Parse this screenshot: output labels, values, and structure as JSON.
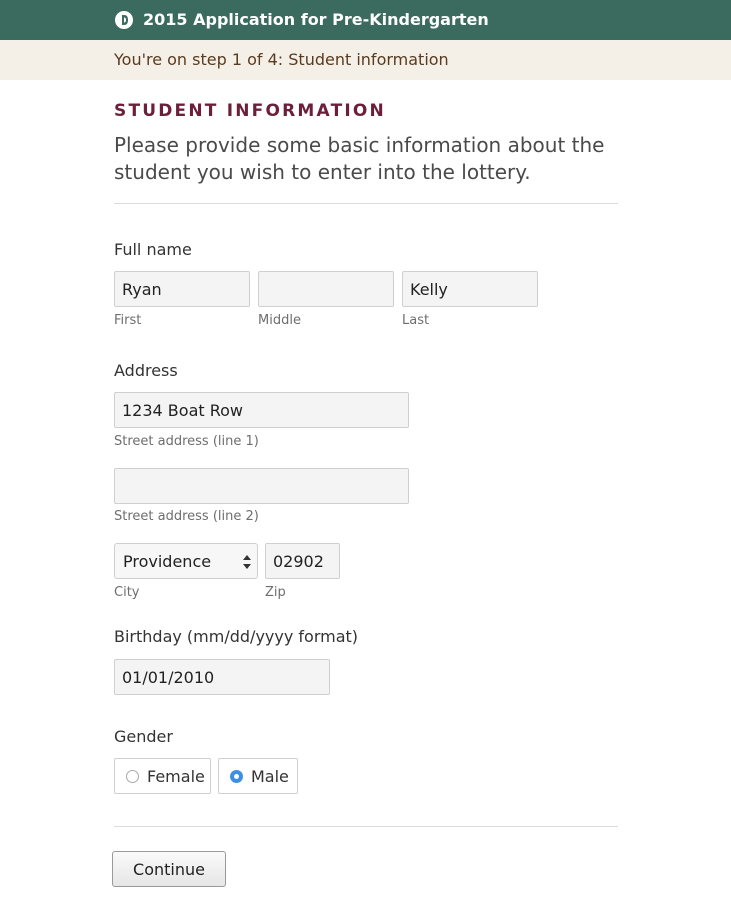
{
  "header": {
    "title": "2015 Application for Pre-Kindergarten",
    "logo_icon": "logo-icon"
  },
  "step": {
    "text": "You're on step 1 of 4: Student information"
  },
  "section": {
    "heading": "STUDENT INFORMATION",
    "intro": "Please provide some basic information about the student you wish to enter into the lottery."
  },
  "full_name": {
    "label": "Full name",
    "first": {
      "value": "Ryan",
      "hint": "First"
    },
    "middle": {
      "value": "",
      "hint": "Middle"
    },
    "last": {
      "value": "Kelly",
      "hint": "Last"
    }
  },
  "address": {
    "label": "Address",
    "line1": {
      "value": "1234 Boat Row",
      "hint": "Street address (line 1)"
    },
    "line2": {
      "value": "",
      "hint": "Street address (line 2)"
    },
    "city": {
      "value": "Providence",
      "hint": "City"
    },
    "zip": {
      "value": "02902",
      "hint": "Zip"
    }
  },
  "birthday": {
    "label": "Birthday (mm/dd/yyyy format)",
    "value": "01/01/2010"
  },
  "gender": {
    "label": "Gender",
    "options": [
      {
        "label": "Female",
        "checked": false
      },
      {
        "label": "Male",
        "checked": true
      }
    ]
  },
  "actions": {
    "continue_label": "Continue"
  },
  "colors": {
    "header_bg": "#3a6b5e",
    "step_bg": "#f4efe7",
    "heading": "#6b1f3b",
    "radio_checked": "#3d8fe6"
  }
}
